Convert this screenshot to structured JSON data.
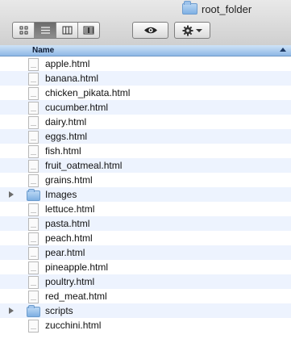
{
  "window": {
    "title": "root_folder",
    "title_icon": "folder-icon"
  },
  "toolbar": {
    "view_modes": [
      {
        "name": "icon-view",
        "icon": "grid-icon",
        "active": false
      },
      {
        "name": "list-view",
        "icon": "list-icon",
        "active": true
      },
      {
        "name": "column-view",
        "icon": "columns-icon",
        "active": false
      },
      {
        "name": "coverflow-view",
        "icon": "coverflow-icon",
        "active": false
      }
    ],
    "quicklook_icon": "eye-icon",
    "action_icon": "gear-icon",
    "action_dropdown_icon": "chevron-down-icon"
  },
  "list": {
    "column_header": "Name",
    "sort_icon": "sort-ascending-icon",
    "items": [
      {
        "name": "apple.html",
        "kind": "file"
      },
      {
        "name": "banana.html",
        "kind": "file"
      },
      {
        "name": "chicken_pikata.html",
        "kind": "file"
      },
      {
        "name": "cucumber.html",
        "kind": "file"
      },
      {
        "name": "dairy.html",
        "kind": "file"
      },
      {
        "name": "eggs.html",
        "kind": "file"
      },
      {
        "name": "fish.html",
        "kind": "file"
      },
      {
        "name": "fruit_oatmeal.html",
        "kind": "file"
      },
      {
        "name": "grains.html",
        "kind": "file"
      },
      {
        "name": "Images",
        "kind": "folder"
      },
      {
        "name": "lettuce.html",
        "kind": "file"
      },
      {
        "name": "pasta.html",
        "kind": "file"
      },
      {
        "name": "peach.html",
        "kind": "file"
      },
      {
        "name": "pear.html",
        "kind": "file"
      },
      {
        "name": "pineapple.html",
        "kind": "file"
      },
      {
        "name": "poultry.html",
        "kind": "file"
      },
      {
        "name": "red_meat.html",
        "kind": "file"
      },
      {
        "name": "scripts",
        "kind": "folder"
      },
      {
        "name": "zucchini.html",
        "kind": "file"
      }
    ]
  },
  "colors": {
    "header_blue": "#8fb8e6",
    "stripe": "#edf3fe",
    "folder_blue": "#7eafe2"
  }
}
